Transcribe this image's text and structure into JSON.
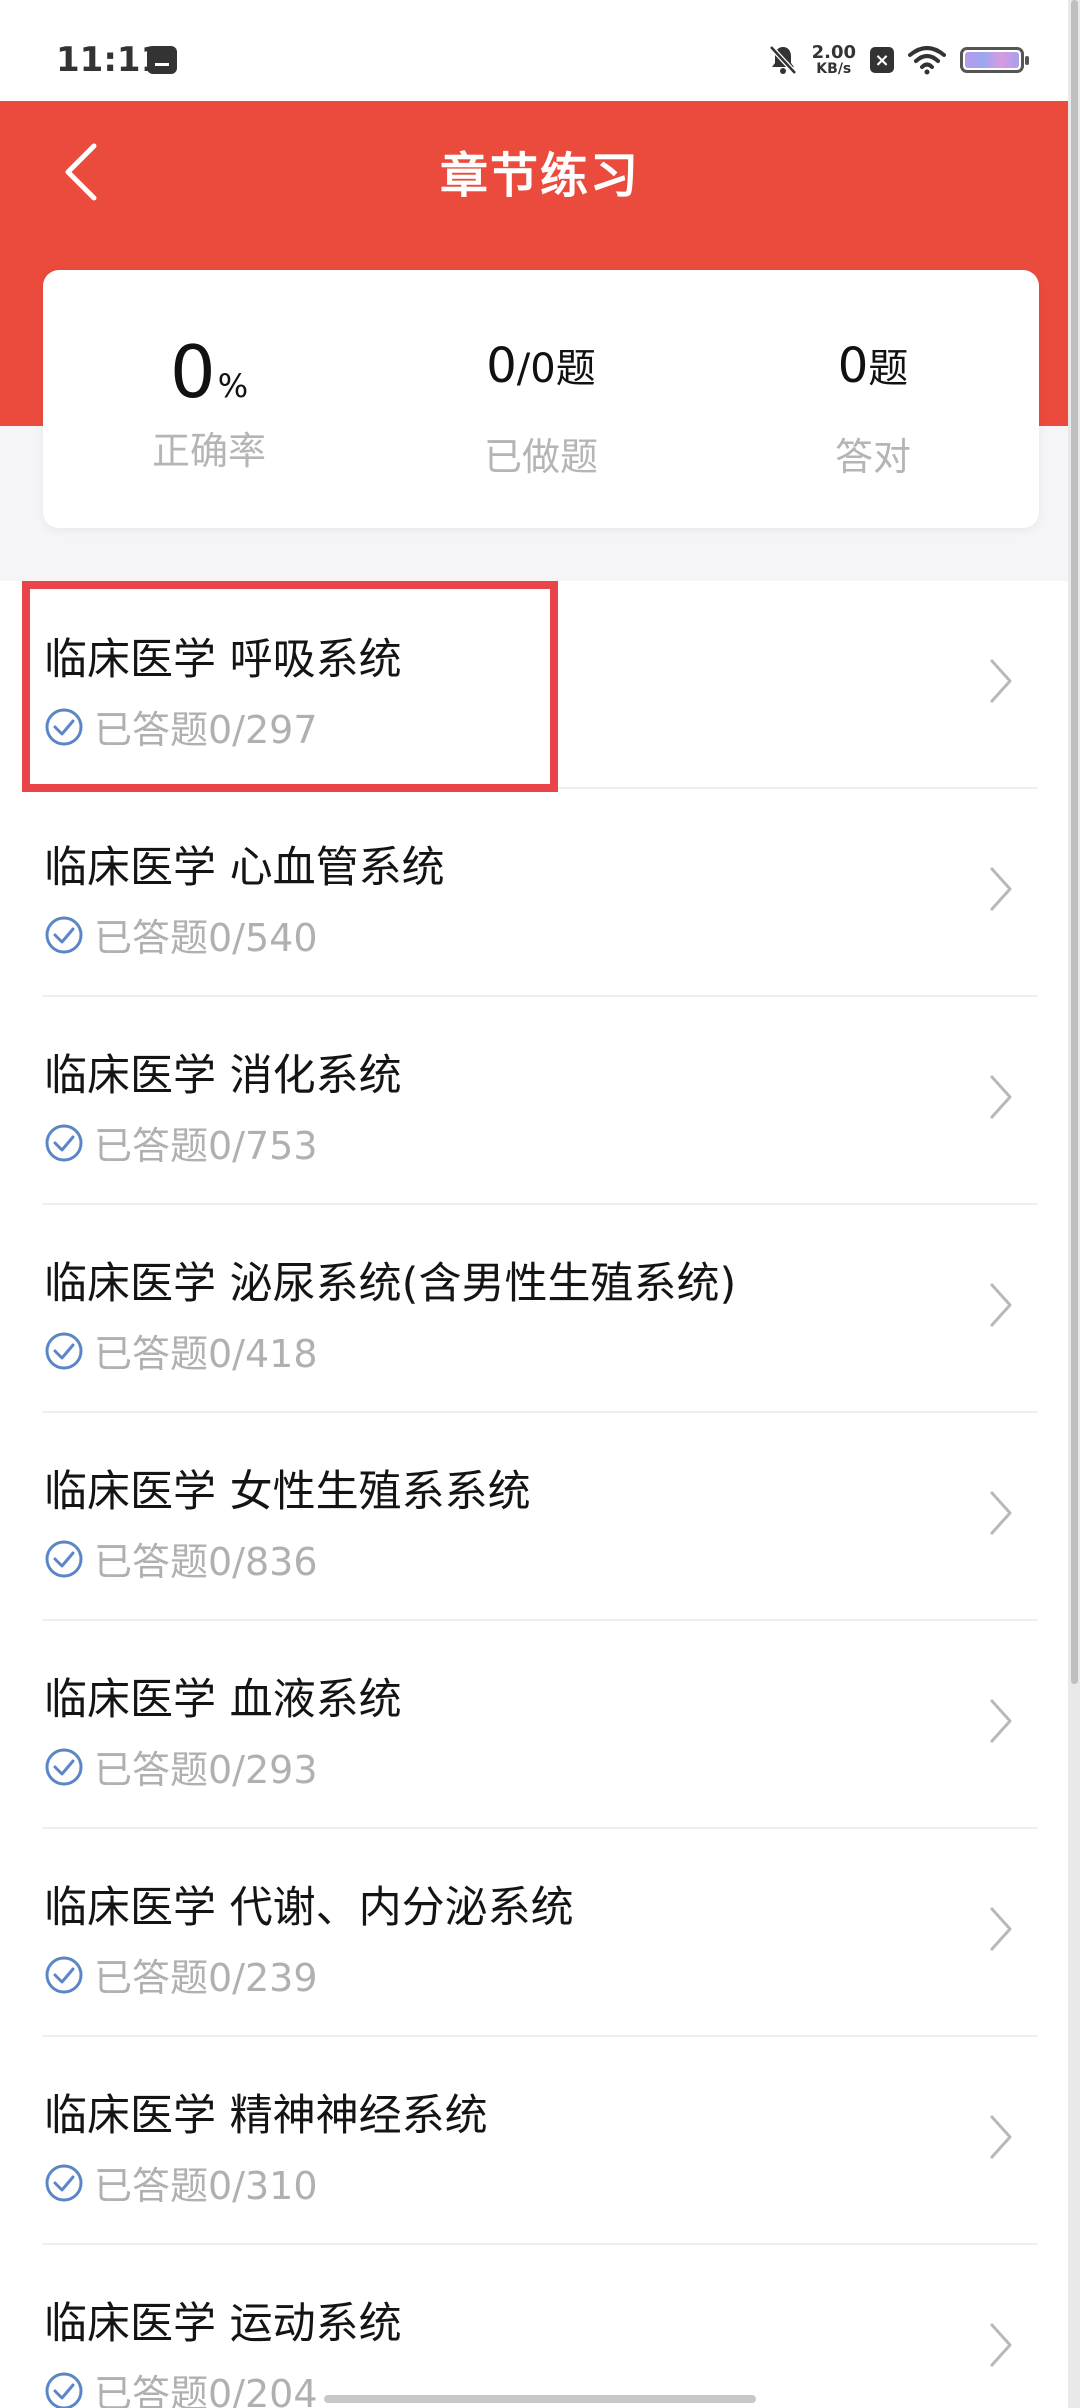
{
  "status_bar": {
    "time": "11:11",
    "net_speed_value": "2.00",
    "net_speed_unit": "KB/s",
    "x_badge": "×"
  },
  "header": {
    "title": "章节练习"
  },
  "stats": {
    "accuracy_value": "0",
    "accuracy_unit": "%",
    "accuracy_label": "正确率",
    "done_value": "0",
    "done_total": "/0题",
    "done_label": "已做题",
    "correct_value": "0",
    "correct_unit": "题",
    "correct_label": "答对"
  },
  "chapters": [
    {
      "title": "临床医学 呼吸系统",
      "progress": "已答题0/297"
    },
    {
      "title": "临床医学 心血管系统",
      "progress": "已答题0/540"
    },
    {
      "title": "临床医学 消化系统",
      "progress": "已答题0/753"
    },
    {
      "title": "临床医学 泌尿系统(含男性生殖系统)",
      "progress": "已答题0/418"
    },
    {
      "title": "临床医学 女性生殖系系统",
      "progress": "已答题0/836"
    },
    {
      "title": "临床医学 血液系统",
      "progress": "已答题0/293"
    },
    {
      "title": "临床医学 代谢、内分泌系统",
      "progress": "已答题0/239"
    },
    {
      "title": "临床医学 精神神经系统",
      "progress": "已答题0/310"
    },
    {
      "title": "临床医学 运动系统",
      "progress": "已答题0/204"
    }
  ],
  "colors": {
    "header_red": "#eb4b3c",
    "highlight": "#e8444a",
    "check_blue": "#5a86c8"
  },
  "icons": {
    "back": "chevron-left-icon",
    "row_arrow": "chevron-right-icon",
    "progress": "check-circle-icon"
  }
}
